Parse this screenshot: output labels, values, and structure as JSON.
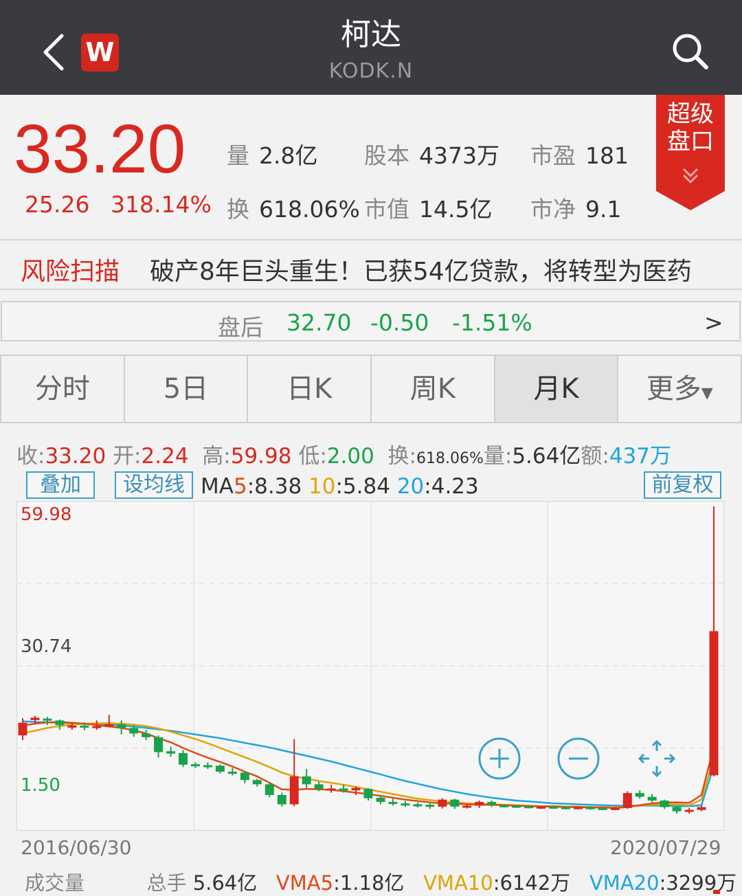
{
  "header": {
    "title": "柯达",
    "ticker": "KODK.N",
    "logo_letter": "W"
  },
  "quote": {
    "price": "33.20",
    "change": "25.26",
    "change_pct": "318.14%",
    "volume_label": "量",
    "volume": "2.8亿",
    "shares_label": "股本",
    "shares": "4373万",
    "pe_label": "市盈",
    "pe": "181",
    "turnover_label": "换",
    "turnover": "618.06%",
    "mktcap_label": "市值",
    "mktcap": "14.5亿",
    "pb_label": "市净",
    "pb": "9.1",
    "super_panel": "超级盘口"
  },
  "risk": {
    "label": "风险扫描",
    "headline": "破产8年巨头重生！已获54亿贷款，将转型为医药"
  },
  "after_hours": {
    "label": "盘后",
    "price": "32.70",
    "change": "-0.50",
    "change_pct": "-1.51%",
    "arrow": ">"
  },
  "tabs": [
    "分时",
    "5日",
    "日K",
    "周K",
    "月K",
    "更多"
  ],
  "active_tab": "月K",
  "kline_info": {
    "close_label": "收:",
    "close": "33.20",
    "open_label": "开:",
    "open": "2.24",
    "high_label": "高:",
    "high": "59.98",
    "low_label": "低:",
    "low": "2.00",
    "turn_label": "换:",
    "turn": "618.06%",
    "vol_label": "量:",
    "vol": "5.64亿",
    "amt_label": "额:",
    "amt": "437万"
  },
  "controls": {
    "overlay": "叠加",
    "set_ma": "设均线",
    "adjust": "前复权",
    "ma5_label": "MA5",
    "ma5": "8.38",
    "ma10_label": "10",
    "ma10": "5.84",
    "ma20_label": "20",
    "ma20": "4.23"
  },
  "chart_data": {
    "type": "candlestick",
    "y_axis_labels": [
      "59.98",
      "30.74",
      "1.50"
    ],
    "x_range": [
      "2016/06/30",
      "2020/07/29"
    ],
    "ylim": [
      1.5,
      59.98
    ],
    "candles": [
      {
        "o": 10.8,
        "c": 13.5,
        "h": 14.5,
        "l": 9.8
      },
      {
        "o": 14.1,
        "c": 14.6,
        "h": 15.0,
        "l": 13.2
      },
      {
        "o": 14.4,
        "c": 14.0,
        "h": 14.8,
        "l": 13.0
      },
      {
        "o": 14.0,
        "c": 13.0,
        "h": 14.2,
        "l": 12.0
      },
      {
        "o": 12.6,
        "c": 12.9,
        "h": 13.5,
        "l": 12.0
      },
      {
        "o": 12.9,
        "c": 12.5,
        "h": 13.6,
        "l": 11.9
      },
      {
        "o": 12.4,
        "c": 12.8,
        "h": 14.0,
        "l": 12.0
      },
      {
        "o": 12.8,
        "c": 13.2,
        "h": 15.2,
        "l": 12.6
      },
      {
        "o": 13.2,
        "c": 12.4,
        "h": 14.0,
        "l": 11.0
      },
      {
        "o": 12.4,
        "c": 11.2,
        "h": 13.0,
        "l": 10.5
      },
      {
        "o": 11.2,
        "c": 10.4,
        "h": 12.0,
        "l": 9.8
      },
      {
        "o": 10.4,
        "c": 7.2,
        "h": 10.8,
        "l": 6.0
      },
      {
        "o": 7.4,
        "c": 6.9,
        "h": 8.4,
        "l": 6.2
      },
      {
        "o": 7.0,
        "c": 4.5,
        "h": 7.6,
        "l": 4.0
      },
      {
        "o": 4.6,
        "c": 4.4,
        "h": 5.0,
        "l": 3.8
      },
      {
        "o": 4.4,
        "c": 4.2,
        "h": 5.0,
        "l": 3.6
      },
      {
        "o": 4.3,
        "c": 3.0,
        "h": 4.6,
        "l": 2.6
      },
      {
        "o": 3.0,
        "c": 2.8,
        "h": 3.8,
        "l": 2.2
      },
      {
        "o": 2.8,
        "c": 1.2,
        "h": 3.0,
        "l": 0.5
      },
      {
        "o": 1.2,
        "c": 0.3,
        "h": 1.5,
        "l": -0.2
      },
      {
        "o": 0.3,
        "c": -2.0,
        "h": 0.8,
        "l": -2.5
      },
      {
        "o": -2.0,
        "c": -4.0,
        "h": -1.5,
        "l": -4.5
      },
      {
        "o": -4.0,
        "c": 2.0,
        "h": 10.0,
        "l": -4.4
      },
      {
        "o": 2.0,
        "c": 0.3,
        "h": 3.6,
        "l": -0.5
      },
      {
        "o": 0.3,
        "c": -0.7,
        "h": 0.8,
        "l": -1.2
      },
      {
        "o": -0.7,
        "c": -0.6,
        "h": 0.2,
        "l": -1.5
      },
      {
        "o": -0.6,
        "c": -1.0,
        "h": 0.2,
        "l": -1.5
      },
      {
        "o": -1.0,
        "c": -0.5,
        "h": -0.2,
        "l": -2.0
      },
      {
        "o": -0.7,
        "c": -2.7,
        "h": -0.5,
        "l": -3.2
      },
      {
        "o": -2.6,
        "c": -3.5,
        "h": -2.2,
        "l": -4.0
      },
      {
        "o": -3.5,
        "c": -3.8,
        "h": -2.8,
        "l": -4.3
      },
      {
        "o": -3.8,
        "c": -4.0,
        "h": -3.3,
        "l": -4.6
      },
      {
        "o": -4.0,
        "c": -4.1,
        "h": -3.6,
        "l": -4.7
      },
      {
        "o": -4.1,
        "c": -4.5,
        "h": -3.8,
        "l": -5.0
      },
      {
        "o": -4.5,
        "c": -3.0,
        "h": -2.7,
        "l": -4.9
      },
      {
        "o": -3.0,
        "c": -4.5,
        "h": -2.8,
        "l": -5.0
      },
      {
        "o": -4.5,
        "c": -4.3,
        "h": -4.0,
        "l": -4.9
      },
      {
        "o": -4.3,
        "c": -3.5,
        "h": -3.2,
        "l": -4.8
      },
      {
        "o": -3.5,
        "c": -4.2,
        "h": -3.2,
        "l": -4.6
      },
      {
        "o": -4.2,
        "c": -4.3,
        "h": -4.0,
        "l": -4.7
      },
      {
        "o": -4.3,
        "c": -4.4,
        "h": -4.1,
        "l": -4.8
      },
      {
        "o": -4.4,
        "c": -4.6,
        "h": -4.2,
        "l": -4.9
      },
      {
        "o": -4.6,
        "c": -4.5,
        "h": -4.3,
        "l": -5.0
      },
      {
        "o": -4.5,
        "c": -4.6,
        "h": -4.3,
        "l": -5.0
      },
      {
        "o": -4.6,
        "c": -4.7,
        "h": -4.4,
        "l": -5.1
      },
      {
        "o": -4.7,
        "c": -4.6,
        "h": -4.5,
        "l": -5.1
      },
      {
        "o": -4.6,
        "c": -4.8,
        "h": -4.4,
        "l": -5.2
      },
      {
        "o": -4.8,
        "c": -4.9,
        "h": -4.6,
        "l": -5.2
      },
      {
        "o": -4.9,
        "c": -4.8,
        "h": -4.6,
        "l": -5.3
      },
      {
        "o": -4.8,
        "c": -1.6,
        "h": -1.2,
        "l": -5.0
      },
      {
        "o": -1.6,
        "c": -2.4,
        "h": -1.0,
        "l": -2.8
      },
      {
        "o": -2.4,
        "c": -3.2,
        "h": -1.8,
        "l": -3.6
      },
      {
        "o": -3.2,
        "c": -4.6,
        "h": -3.0,
        "l": -5.0
      },
      {
        "o": -4.6,
        "c": -5.5,
        "h": -4.3,
        "l": -6.0
      },
      {
        "o": -5.5,
        "c": -5.2,
        "h": -4.8,
        "l": -6.0
      },
      {
        "o": -5.2,
        "c": -4.6,
        "h": -4.3,
        "l": -5.5
      },
      {
        "o": 2.24,
        "c": 33.2,
        "h": 59.98,
        "l": 2.0
      }
    ],
    "ma5": [
      12.9,
      13.3,
      13.6,
      13.7,
      13.5,
      13.3,
      13.0,
      12.7,
      12.4,
      11.9,
      11.2,
      10.2,
      9.3,
      8.1,
      7.0,
      6.0,
      5.1,
      4.1,
      3.0,
      2.0,
      0.6,
      -0.8,
      -0.9,
      -0.7,
      -0.8,
      -0.9,
      -1.2,
      -1.5,
      -1.8,
      -2.2,
      -2.6,
      -3.0,
      -3.3,
      -3.6,
      -3.8,
      -3.9,
      -4.0,
      -4.1,
      -4.1,
      -4.2,
      -4.3,
      -4.4,
      -4.5,
      -4.5,
      -4.6,
      -4.6,
      -4.7,
      -4.7,
      -4.8,
      -4.6,
      -4.2,
      -3.8,
      -3.6,
      -3.6,
      -3.7,
      -2.0,
      8.38
    ],
    "ma10": [
      11.3,
      11.8,
      12.4,
      12.8,
      13.1,
      13.3,
      13.4,
      13.4,
      13.3,
      13.1,
      12.8,
      12.3,
      11.6,
      10.8,
      10.0,
      9.1,
      8.1,
      7.1,
      6.1,
      5.1,
      4.0,
      2.8,
      2.0,
      1.5,
      1.0,
      0.6,
      0.2,
      -0.3,
      -0.8,
      -1.3,
      -1.8,
      -2.3,
      -2.8,
      -3.1,
      -3.4,
      -3.6,
      -3.8,
      -3.9,
      -4.0,
      -4.1,
      -4.2,
      -4.3,
      -4.4,
      -4.4,
      -4.5,
      -4.5,
      -4.6,
      -4.6,
      -4.7,
      -4.5,
      -4.3,
      -4.1,
      -4.0,
      -4.0,
      -4.2,
      -3.0,
      5.84
    ],
    "ma20": [
      13.8,
      13.7,
      13.6,
      13.5,
      13.4,
      13.3,
      13.2,
      13.1,
      12.9,
      12.7,
      12.4,
      12.1,
      11.8,
      11.4,
      11.0,
      10.6,
      10.2,
      9.7,
      9.2,
      8.7,
      8.2,
      7.6,
      7.0,
      6.4,
      5.8,
      5.2,
      4.5,
      3.8,
      3.1,
      2.4,
      1.7,
      1.0,
      0.4,
      -0.2,
      -0.8,
      -1.3,
      -1.8,
      -2.2,
      -2.6,
      -2.9,
      -3.2,
      -3.4,
      -3.6,
      -3.8,
      -3.9,
      -4.0,
      -4.1,
      -4.2,
      -4.3,
      -4.3,
      -4.3,
      -4.3,
      -4.3,
      -4.4,
      -4.4,
      -4.2,
      4.23
    ]
  },
  "chart_dates": {
    "start": "2016/06/30",
    "end": "2020/07/29"
  },
  "volume": {
    "label": "成交量",
    "total_label": "总手",
    "total": "5.64亿",
    "vma5_label": "VMA5",
    "vma5": "1.18亿",
    "vma10_label": "VMA10",
    "vma10": "6142万",
    "vma20_label": "VMA20",
    "vma20": "3299万"
  },
  "colors": {
    "up": "#d9281f",
    "down": "#18a34a",
    "ma5": "#e04a18",
    "ma10": "#e0a300",
    "ma20": "#1da5e0"
  }
}
